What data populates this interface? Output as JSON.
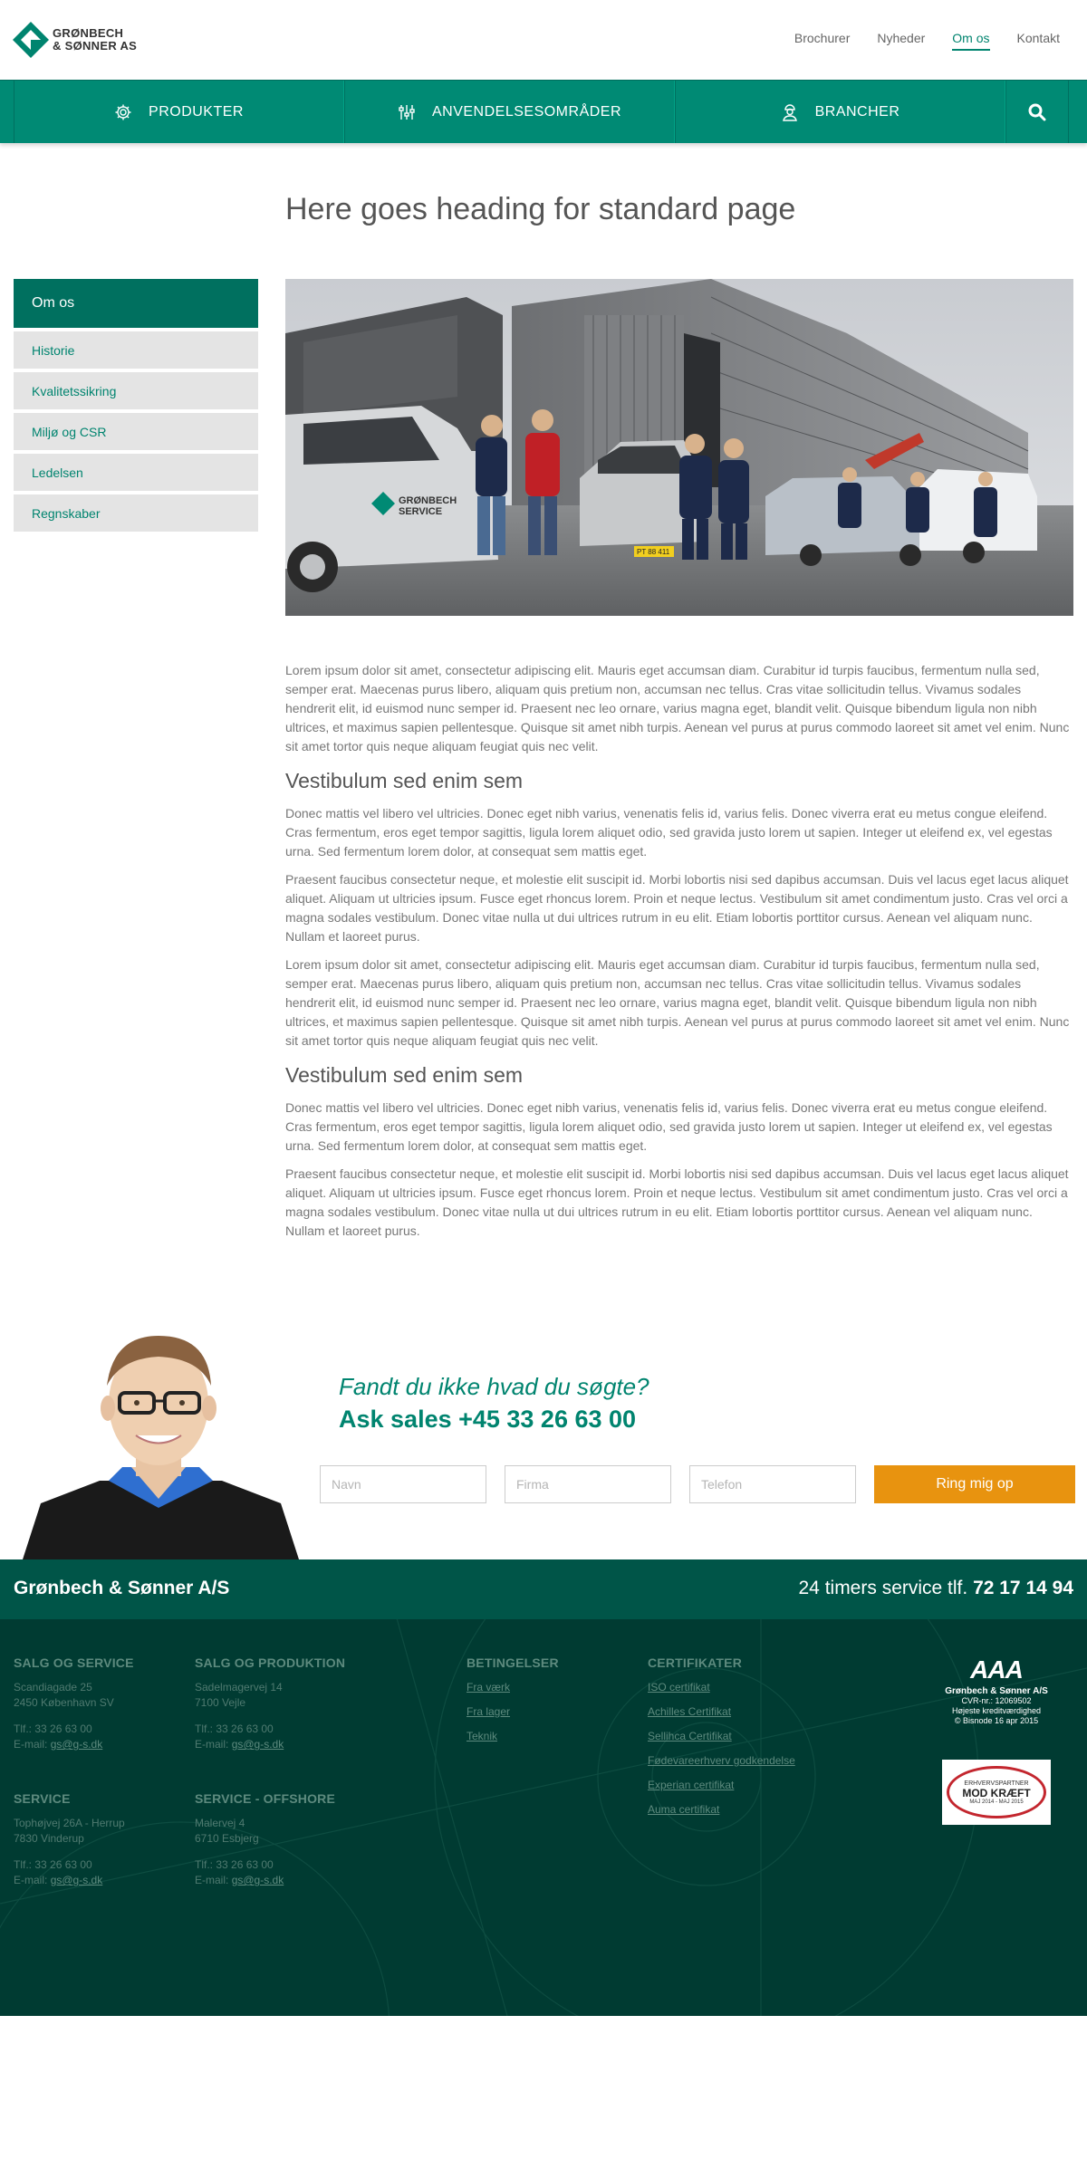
{
  "brand": {
    "line1": "GRØNBECH",
    "line2": "& SØNNER AS",
    "color": "#008a74",
    "accent": "#e8930f"
  },
  "top_nav": [
    "Brochurer",
    "Nyheder",
    "Om os",
    "Kontakt"
  ],
  "top_nav_active": "Om os",
  "main_nav": [
    {
      "label": "PRODUKTER",
      "icon": "gear-icon"
    },
    {
      "label": "ANVENDELSESOMRÅDER",
      "icon": "sliders-icon"
    },
    {
      "label": "BRANCHER",
      "icon": "worker-icon"
    }
  ],
  "page": {
    "title": "Here goes heading for standard page"
  },
  "sidebar": {
    "heading": "Om os",
    "items": [
      "Historie",
      "Kvalitetssikring",
      "Miljø og CSR",
      "Ledelsen",
      "Regnskaber"
    ]
  },
  "hero": {
    "van_text_1": "GRØNBECH",
    "van_text_2": "SERVICE",
    "plate": "PT 88 411"
  },
  "article": {
    "p1": "Lorem ipsum dolor sit amet, consectetur adipiscing elit. Mauris eget accumsan diam. Curabitur id turpis faucibus, fermentum nulla sed, semper erat. Maecenas purus libero, aliquam quis pretium non, accumsan nec tellus. Cras vitae sollicitudin tellus. Vivamus sodales hendrerit elit, id euismod nunc semper id. Praesent nec leo ornare, varius magna eget, blandit velit. Quisque bibendum ligula non nibh ultrices, et maximus sapien pellentesque. Quisque sit amet nibh turpis. Aenean vel purus at purus commodo laoreet sit amet vel enim. Nunc sit amet tortor quis neque aliquam feugiat quis nec velit.",
    "h1": "Vestibulum sed enim sem",
    "p2": "Donec mattis vel libero vel ultricies. Donec eget nibh varius, venenatis felis id, varius felis. Donec viverra erat eu metus congue eleifend. Cras fermentum, eros eget tempor sagittis, ligula lorem aliquet odio, sed gravida justo lorem ut sapien. Integer ut eleifend ex, vel egestas urna. Sed fermentum lorem dolor, at consequat sem mattis eget.",
    "p3": "Praesent faucibus consectetur neque, et molestie elit suscipit id. Morbi lobortis nisi sed dapibus accumsan. Duis vel lacus eget lacus aliquet aliquet. Aliquam ut ultricies ipsum. Fusce eget rhoncus lorem. Proin et neque lectus. Vestibulum sit amet condimentum justo. Cras vel orci a magna sodales vestibulum. Donec vitae nulla ut dui ultrices rutrum in eu elit. Etiam lobortis porttitor cursus. Aenean vel aliquam nunc. Nullam et laoreet purus.",
    "p4": "Lorem ipsum dolor sit amet, consectetur adipiscing elit. Mauris eget accumsan diam. Curabitur id turpis faucibus, fermentum nulla sed, semper erat. Maecenas purus libero, aliquam quis pretium non, accumsan nec tellus. Cras vitae sollicitudin tellus. Vivamus sodales hendrerit elit, id euismod nunc semper id. Praesent nec leo ornare, varius magna eget, blandit velit. Quisque bibendum ligula non nibh ultrices, et maximus sapien pellentesque. Quisque sit amet nibh turpis. Aenean vel purus at purus commodo laoreet sit amet vel enim. Nunc sit amet tortor quis neque aliquam feugiat quis nec velit.",
    "h2": "Vestibulum sed enim sem",
    "p5": "Donec mattis vel libero vel ultricies. Donec eget nibh varius, venenatis felis id, varius felis. Donec viverra erat eu metus congue eleifend. Cras fermentum, eros eget tempor sagittis, ligula lorem aliquet odio, sed gravida justo lorem ut sapien. Integer ut eleifend ex, vel egestas urna. Sed fermentum lorem dolor, at consequat sem mattis eget.",
    "p6": "Praesent faucibus consectetur neque, et molestie elit suscipit id. Morbi lobortis nisi sed dapibus accumsan. Duis vel lacus eget lacus aliquet aliquet. Aliquam ut ultricies ipsum. Fusce eget rhoncus lorem. Proin et neque lectus. Vestibulum sit amet condimentum justo. Cras vel orci a magna sodales vestibulum. Donec vitae nulla ut dui ultrices rutrum in eu elit. Etiam lobortis porttitor cursus. Aenean vel aliquam nunc. Nullam et laoreet purus."
  },
  "sales": {
    "question": "Fandt du ikke hvad du søgte?",
    "phone_line": "Ask sales +45 33 26 63 00",
    "name_placeholder": "Navn",
    "company_placeholder": "Firma",
    "phone_placeholder": "Telefon",
    "button": "Ring mig op"
  },
  "footer_bar": {
    "company": "Grønbech & Sønner A/S",
    "service_label": "24 timers service tlf.",
    "service_phone": "72 17 14 94"
  },
  "footer": {
    "salg_service": {
      "title": "SALG OG SERVICE",
      "addr1": "Scandiagade 25",
      "addr2": "2450 København SV",
      "tel": "Tlf.: 33 26 63 00",
      "email_label": "E-mail:",
      "email": "gs@g-s.dk"
    },
    "salg_produktion": {
      "title": "SALG OG PRODUKTION",
      "addr1": "Sadelmagervej 14",
      "addr2": "7100 Vejle",
      "tel": "Tlf.: 33 26 63 00",
      "email_label": "E-mail:",
      "email": "gs@g-s.dk"
    },
    "service": {
      "title": "SERVICE",
      "addr1": "Tophøjvej 26A - Herrup",
      "addr2": "7830 Vinderup",
      "tel": "Tlf.: 33 26 63 00",
      "email_label": "E-mail:",
      "email": "gs@g-s.dk"
    },
    "offshore": {
      "title": "SERVICE - OFFSHORE",
      "addr1": "Malervej 4",
      "addr2": "6710 Esbjerg",
      "tel": "Tlf.: 33 26 63 00",
      "email_label": "E-mail:",
      "email": "gs@g-s.dk"
    },
    "betingelser": {
      "title": "BETINGELSER",
      "links": [
        "Fra værk",
        "Fra lager",
        "Teknik"
      ]
    },
    "certifikater": {
      "title": "CERTIFIKATER",
      "links": [
        "ISO certifikat",
        "Achilles Certifikat",
        "Sellihca Certifikat",
        "Fødevareerhverv godkendelse",
        "Experian certifikat",
        "Auma certifikat"
      ]
    },
    "aaa": {
      "rating": "AAA",
      "company": "Grønbech & Sønner A/S",
      "cvr": "CVR-nr.: 12069502",
      "line": "Højeste kreditværdighed",
      "source": "© Bisnode 16 apr 2015"
    },
    "badge": {
      "top": "ERHVERVSPARTNER",
      "main": "MOD KRÆFT",
      "dates": "MAJ 2014 - MAJ 2015"
    }
  }
}
